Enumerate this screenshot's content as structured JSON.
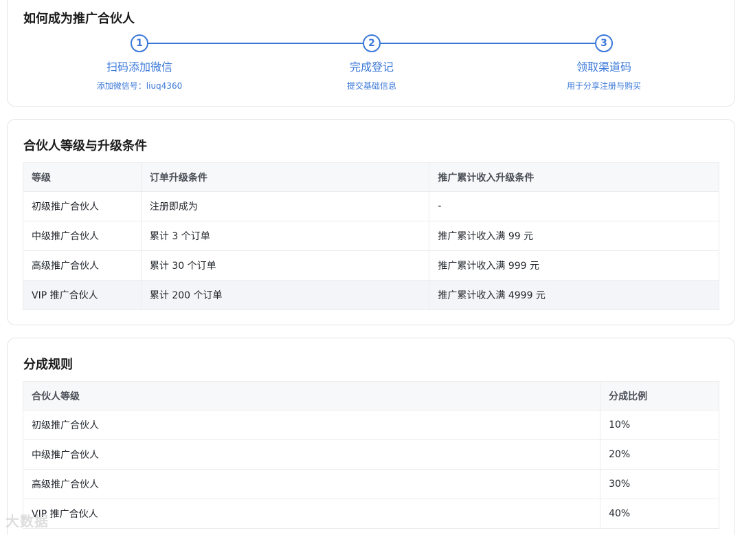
{
  "steps_section": {
    "title": "如何成为推广合伙人",
    "steps": [
      {
        "number": "1",
        "title": "扫码添加微信",
        "desc": "添加微信号：liuq4360"
      },
      {
        "number": "2",
        "title": "完成登记",
        "desc": "提交基础信息"
      },
      {
        "number": "3",
        "title": "领取渠道码",
        "desc": "用于分享注册与购买"
      }
    ]
  },
  "levels_section": {
    "title": "合伙人等级与升级条件",
    "headers": [
      "等级",
      "订单升级条件",
      "推广累计收入升级条件"
    ],
    "rows": [
      [
        "初级推广合伙人",
        "注册即成为",
        "-"
      ],
      [
        "中级推广合伙人",
        "累计 3 个订单",
        "推广累计收入满 99 元"
      ],
      [
        "高级推广合伙人",
        "累计 30 个订单",
        "推广累计收入满 999 元"
      ],
      [
        "VIP 推广合伙人",
        "累计 200 个订单",
        "推广累计收入满 4999 元"
      ]
    ]
  },
  "commission_section": {
    "title": "分成规则",
    "headers": [
      "合伙人等级",
      "分成比例"
    ],
    "rows": [
      [
        "初级推广合伙人",
        "10%"
      ],
      [
        "中级推广合伙人",
        "20%"
      ],
      [
        "高级推广合伙人",
        "30%"
      ],
      [
        "VIP 推广合伙人",
        "40%"
      ]
    ]
  },
  "watermark": "大数据",
  "colors": {
    "accent": "#3a78d8",
    "border": "#e3e5e8",
    "header_bg": "#f7f8fa"
  }
}
